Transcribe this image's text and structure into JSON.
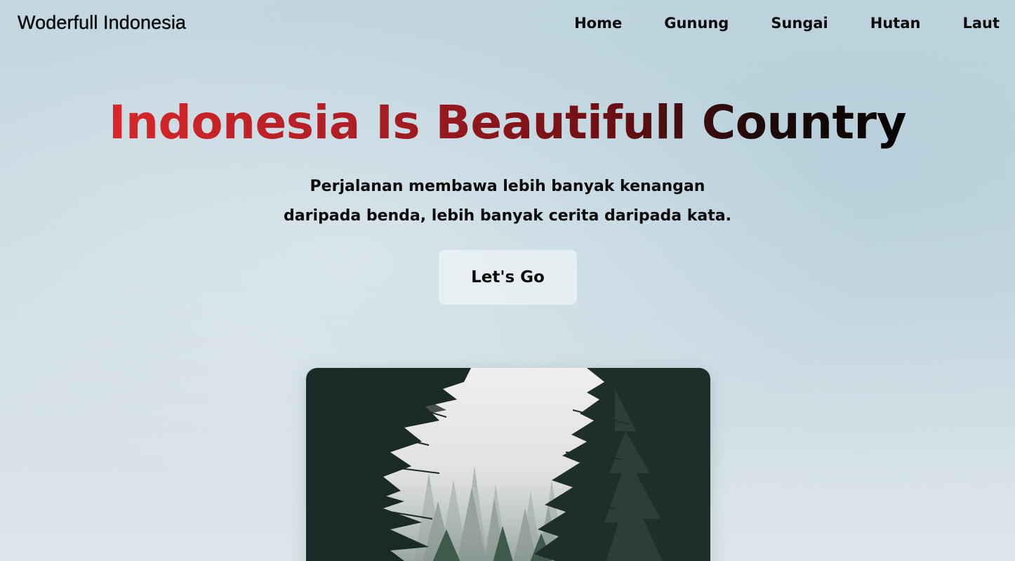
{
  "navbar": {
    "brand": "Woderfull Indonesia",
    "links": [
      "Home",
      "Gunung",
      "Sungai",
      "Hutan",
      "Laut"
    ]
  },
  "hero": {
    "title": "Indonesia Is Beautifull Country",
    "subtitle_line1": "Perjalanan membawa lebih banyak kenangan",
    "subtitle_line2": "daripada benda, lebih banyak cerita daripada kata.",
    "cta_label": "Let's Go"
  },
  "image": {
    "alt": "forest-photo",
    "colors": {
      "sky": "#ecebea",
      "fog": "#cfd3d2",
      "tree_dark": "#1c2a25",
      "tree_mid": "#2f4a3e"
    }
  },
  "colors": {
    "title_gradient_start": "#d9262b",
    "title_gradient_end": "#050303",
    "text": "#0b0b0b",
    "button_bg": "#ecf2f5"
  }
}
